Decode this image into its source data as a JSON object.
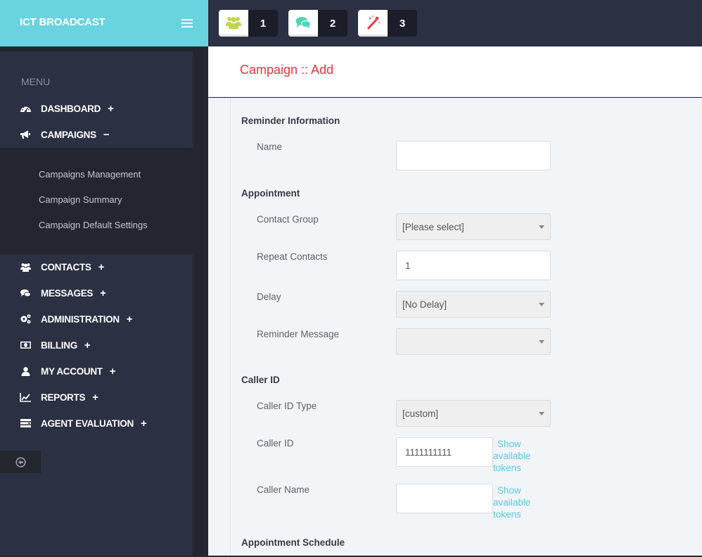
{
  "brand": {
    "title": "ICT BROADCAST"
  },
  "topbar": {
    "badges": [
      {
        "icon": "users-icon",
        "count": "1",
        "color": "#c2d44a"
      },
      {
        "icon": "comments-icon",
        "count": "2",
        "color": "#4fd6b4"
      },
      {
        "icon": "magic-wand-icon",
        "count": "3",
        "color": "#e8343d"
      }
    ]
  },
  "sidebar": {
    "menu_label": "MENU",
    "items": [
      {
        "label": "DASHBOARD",
        "icon": "dashboard-icon",
        "toggle": "+"
      },
      {
        "label": "CAMPAIGNS",
        "icon": "bullhorn-icon",
        "toggle": "−"
      },
      {
        "label": "CONTACTS",
        "icon": "users-icon",
        "toggle": "+"
      },
      {
        "label": "MESSAGES",
        "icon": "comments-icon",
        "toggle": "+"
      },
      {
        "label": "ADMINISTRATION",
        "icon": "cogs-icon",
        "toggle": "+"
      },
      {
        "label": "BILLING",
        "icon": "money-icon",
        "toggle": "+"
      },
      {
        "label": "MY ACCOUNT",
        "icon": "user-icon",
        "toggle": "+"
      },
      {
        "label": "REPORTS",
        "icon": "line-chart-icon",
        "toggle": "+"
      },
      {
        "label": "AGENT EVALUATION",
        "icon": "list-icon",
        "toggle": "+"
      }
    ],
    "campaigns_sub": [
      {
        "label": "Campaigns Management"
      },
      {
        "label": "Campaign Summary"
      },
      {
        "label": "Campaign Default Settings"
      }
    ]
  },
  "page": {
    "title": "Campaign :: Add",
    "sections": {
      "reminder_info": "Reminder Information",
      "appointment": "Appointment",
      "caller_id": "Caller ID",
      "appointment_schedule": "Appointment Schedule"
    },
    "fields": {
      "name": {
        "label": "Name",
        "value": ""
      },
      "contact_group": {
        "label": "Contact Group",
        "value": "[Please select]"
      },
      "repeat_contacts": {
        "label": "Repeat Contacts",
        "value": "1"
      },
      "delay": {
        "label": "Delay",
        "value": "[No Delay]"
      },
      "reminder_message": {
        "label": "Reminder Message",
        "value": ""
      },
      "caller_id_type": {
        "label": "Caller ID Type",
        "value": "[custom]"
      },
      "caller_id": {
        "label": "Caller ID",
        "value": "1111111111"
      },
      "caller_name": {
        "label": "Caller Name",
        "value": ""
      }
    },
    "token_link": {
      "line1": "Show",
      "line2": "available",
      "line3": "tokens"
    }
  }
}
